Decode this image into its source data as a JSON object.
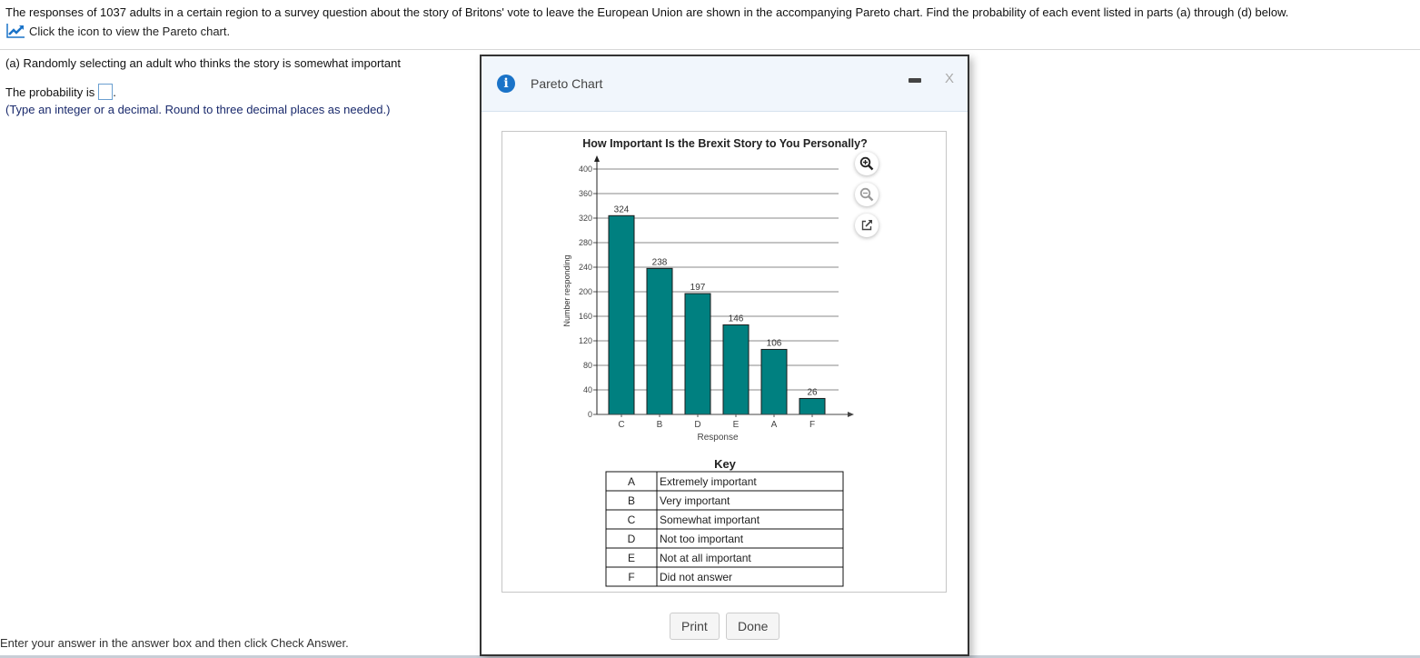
{
  "question": {
    "intro": "The responses of 1037 adults in a certain region to a survey question about the story of Britons' vote to leave the European Union are shown in the accompanying Pareto chart. Find the probability of each event listed in parts (a) through (d) below.",
    "chart_link_text": "Click the icon to view the Pareto chart.",
    "part_a": "(a) Randomly selecting an adult who thinks the story is somewhat important",
    "prob_label": "The probability is",
    "prob_suffix": ".",
    "answer_value": "",
    "hint": "(Type an integer or a decimal. Round to three decimal places as needed.)",
    "footer": "Enter your answer in the answer box and then click Check Answer."
  },
  "dialog": {
    "title": "Pareto Chart",
    "print_label": "Print",
    "done_label": "Done",
    "close_label": "X",
    "key_title": "Key",
    "key": [
      {
        "code": "A",
        "label": "Extremely important"
      },
      {
        "code": "B",
        "label": "Very important"
      },
      {
        "code": "C",
        "label": "Somewhat important"
      },
      {
        "code": "D",
        "label": "Not too important"
      },
      {
        "code": "E",
        "label": "Not at all important"
      },
      {
        "code": "F",
        "label": "Did not answer"
      }
    ]
  },
  "colors": {
    "bar": "#008080",
    "accent": "#1a73c8"
  },
  "chart_data": {
    "type": "bar",
    "title": "How Important Is the Brexit Story to You Personally?",
    "xlabel": "Response",
    "ylabel": "Number responding",
    "categories": [
      "C",
      "B",
      "D",
      "E",
      "A",
      "F"
    ],
    "values": [
      324,
      238,
      197,
      146,
      106,
      26
    ],
    "ylim": [
      0,
      400
    ],
    "yticks": [
      0,
      40,
      80,
      120,
      160,
      200,
      240,
      280,
      320,
      360,
      400
    ],
    "grid": true,
    "legend": "none"
  }
}
